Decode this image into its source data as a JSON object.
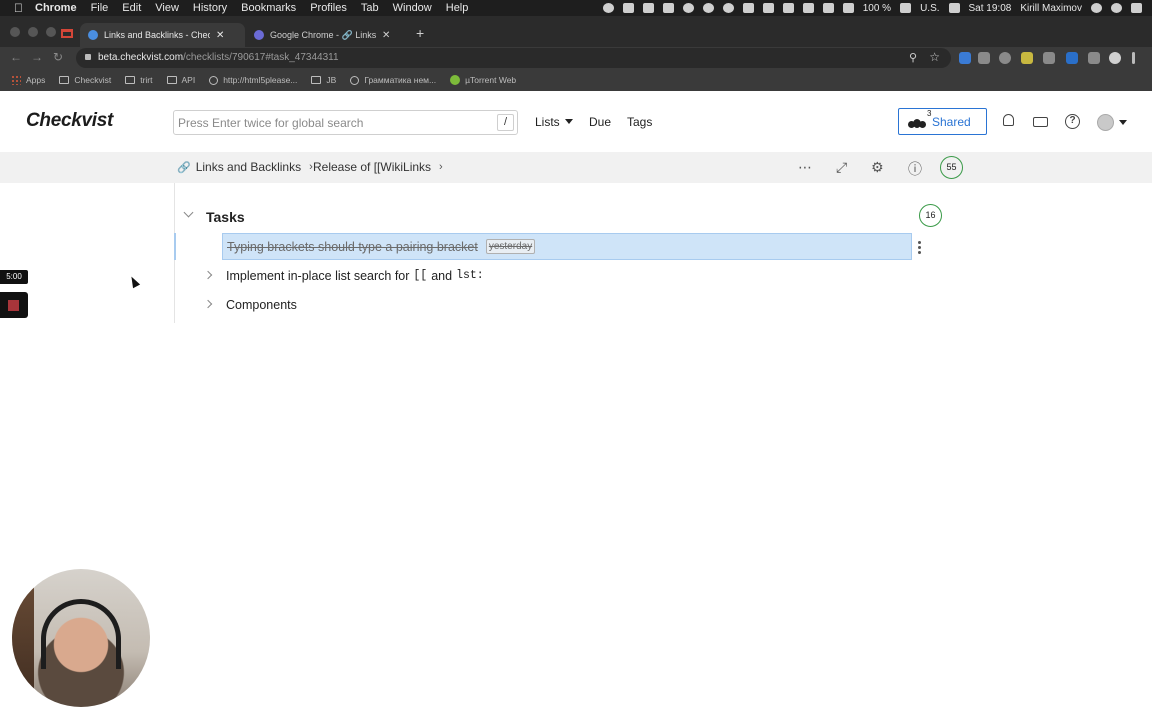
{
  "menubar": {
    "app": "Chrome",
    "items": [
      "File",
      "Edit",
      "View",
      "History",
      "Bookmarks",
      "Profiles",
      "Tab",
      "Window",
      "Help"
    ],
    "battery": "100 %",
    "locale": "U.S.",
    "clock": "Sat 19:08",
    "user": "Kirill Maximov"
  },
  "browser": {
    "tabs": [
      {
        "title": "Links and Backlinks - Checkvist",
        "active": true
      },
      {
        "title": "Google Chrome - 🔗 Links and Backlinks",
        "active": false
      }
    ],
    "url_host": "beta.checkvist.com",
    "url_path": "/checklists/790617#task_47344311",
    "bookmarks": [
      "Apps",
      "Checkvist",
      "trirt",
      "API",
      "http://html5please...",
      "JB",
      "Грамматика нем...",
      "µTorrent Web"
    ]
  },
  "header": {
    "logo": "Checkvist",
    "search_placeholder": "Press Enter twice for global search",
    "search_shortcut": "/",
    "nav": {
      "lists": "Lists",
      "due": "Due",
      "tags": "Tags"
    },
    "shared_label": "Shared",
    "shared_count": "3"
  },
  "breadcrumb": {
    "items": [
      "Links and Backlinks",
      "Release of [[WikiLinks"
    ],
    "badge": "55"
  },
  "section": {
    "title": "Tasks",
    "badge": "16",
    "tasks": [
      {
        "text": "Typing brackets should type a pairing bracket",
        "date": "yesterday",
        "done": true,
        "selected": true
      },
      {
        "text": "Implement in-place list search for",
        "code1": "[[",
        "mid": "and",
        "code2": "lst:",
        "done": false
      },
      {
        "text": "Components",
        "done": false
      }
    ]
  },
  "overlay": {
    "timer": "5:00"
  },
  "colors": {
    "accent": "#2a74d4",
    "selection": "#cfe4f8",
    "badge_ring": "#3a9a48"
  }
}
